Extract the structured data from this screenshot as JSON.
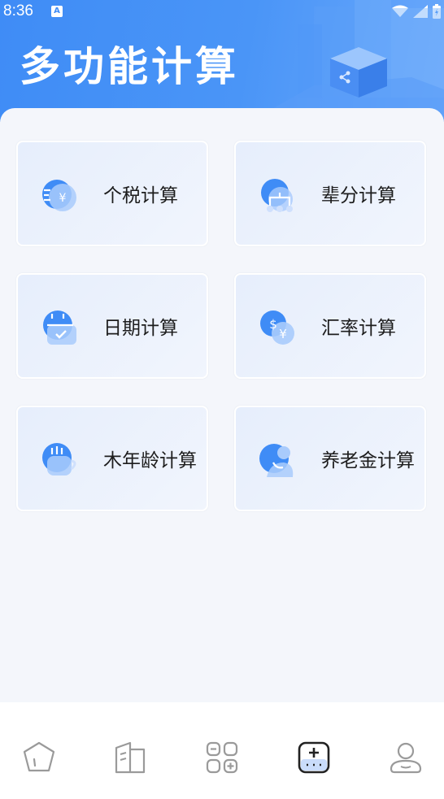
{
  "status_bar": {
    "time": "8:36",
    "notification_glyph": "A"
  },
  "header": {
    "title": "多功能计算"
  },
  "cards": [
    {
      "label": "个税计算",
      "icon": "tax-icon"
    },
    {
      "label": "辈分计算",
      "icon": "family-icon"
    },
    {
      "label": "日期计算",
      "icon": "calendar-icon"
    },
    {
      "label": "汇率计算",
      "icon": "exchange-icon"
    },
    {
      "label": "木年龄计算",
      "icon": "age-icon"
    },
    {
      "label": "养老金计算",
      "icon": "pension-icon"
    }
  ],
  "tabbar": {
    "tabs": [
      {
        "icon": "home-icon",
        "active": false
      },
      {
        "icon": "book-icon",
        "active": false
      },
      {
        "icon": "calculator-grid-icon",
        "active": false
      },
      {
        "icon": "plus-calculator-icon",
        "active": true
      },
      {
        "icon": "user-icon",
        "active": false
      }
    ]
  },
  "colors": {
    "accent": "#3f8cf6",
    "icon_light": "#8fb9fb",
    "tab_inactive": "#9a9a9a",
    "tab_active": "#222222"
  }
}
